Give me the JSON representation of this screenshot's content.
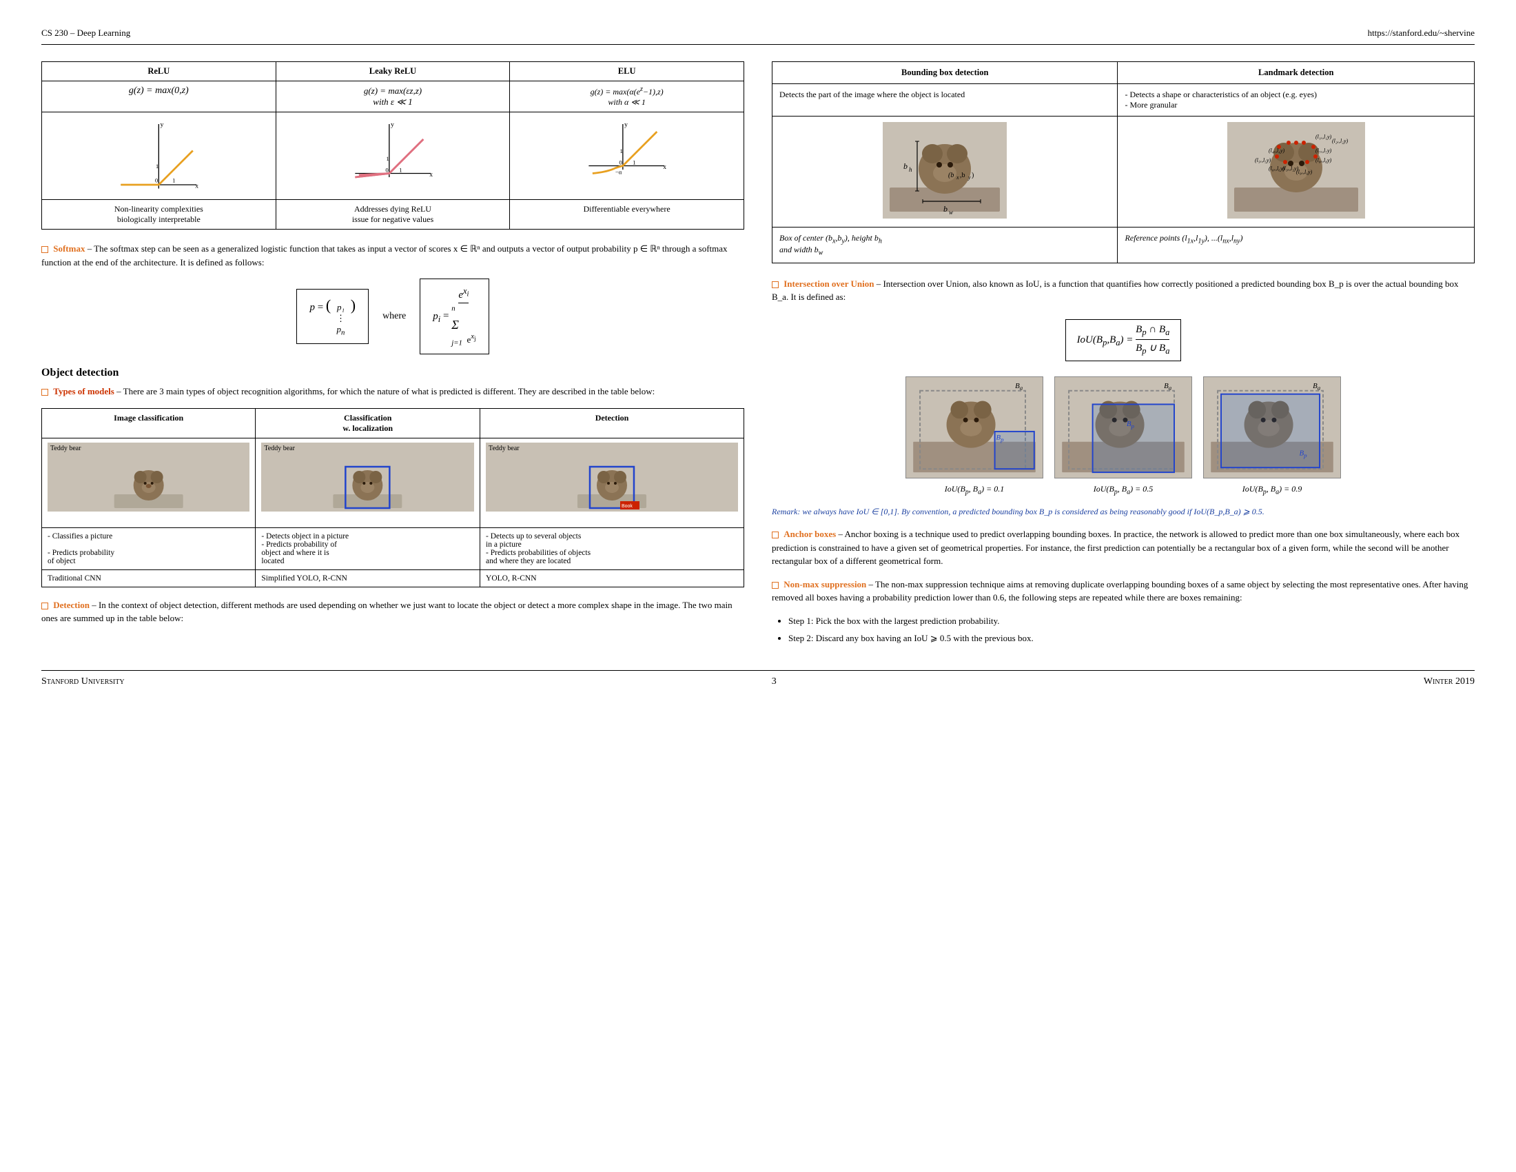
{
  "header": {
    "left": "CS 230 – Deep Learning",
    "right": "https://stanford.edu/~shervine"
  },
  "footer": {
    "left": "Stanford University",
    "center": "3",
    "right": "Winter 2019"
  },
  "activation_table": {
    "columns": [
      "ReLU",
      "Leaky ReLU",
      "ELU"
    ],
    "formulas": [
      "g(z) = max(0,z)",
      "g(z) = max(εz,z) with ε ≪ 1",
      "g(z) = max(α(eᶻ−1),z) with α ≪ 1"
    ],
    "descriptions": [
      "Non-linearity complexities biologically interpretable",
      "Addresses dying ReLU issue for negative values",
      "Differentiable everywhere"
    ]
  },
  "softmax": {
    "label": "Softmax",
    "text": "– The softmax step can be seen as a generalized logistic function that takes as input a vector of scores x ∈ ℝⁿ and outputs a vector of output probability p ∈ ℝⁿ through a softmax function at the end of the architecture. It is defined as follows:"
  },
  "object_detection_title": "Object detection",
  "types_of_models": {
    "label": "Types of models",
    "text": "– There are 3 main types of object recognition algorithms, for which the nature of what is predicted is different. They are described in the table below:",
    "columns": [
      "Image classification",
      "Classification w. localization",
      "Detection"
    ],
    "row1_labels": [
      "Teddy bear",
      "Teddy bear",
      "Teddy bear"
    ],
    "row2": [
      "- Classifies a picture\n- Predicts probability of object",
      "- Detects object in a picture\n- Predicts probability of object and where it is located",
      "- Detects up to several objects in a picture\n- Predicts probabilities of objects and where they are located"
    ],
    "row3": [
      "Traditional CNN",
      "Simplified YOLO, R-CNN",
      "YOLO, R-CNN"
    ]
  },
  "detection": {
    "label": "Detection",
    "text": "– In the context of object detection, different methods are used depending on whether we just want to locate the object or detect a more complex shape in the image. The two main ones are summed up in the table below:"
  },
  "bb_table": {
    "col1": "Bounding box detection",
    "col2": "Landmark detection",
    "desc1": "Detects the part of the image where the object is located",
    "desc2": "- Detects a shape or characteristics of an object (e.g. eyes)\n- More granular",
    "formula1": "Box of center (bₓ,b_y), height b_h and width b_w",
    "formula2": "Reference points (l₁ₓ,l₁y), ...,(l_nₓ,l_ny)"
  },
  "iou": {
    "label": "Intersection over Union",
    "text": "– Intersection over Union, also known as IoU, is a function that quantifies how correctly positioned a predicted bounding box B_p is over the actual bounding box B_a. It is defined as:",
    "formula": "IoU(B_p,B_a) = (B_p ∩ B_a) / (B_p ∪ B_a)",
    "images": [
      {
        "label": "IoU(B_p, B_a) = 0.1"
      },
      {
        "label": "IoU(B_p, B_a) = 0.5"
      },
      {
        "label": "IoU(B_p, B_a) = 0.9"
      }
    ],
    "remark": "Remark: we always have IoU ∈ [0,1]. By convention, a predicted bounding box B_p is considered as being reasonably good if IoU(B_p,B_a) ⩾ 0.5."
  },
  "anchor_boxes": {
    "label": "Anchor boxes",
    "text": "– Anchor boxing is a technique used to predict overlapping bounding boxes. In practice, the network is allowed to predict more than one box simultaneously, where each box prediction is constrained to have a given set of geometrical properties. For instance, the first prediction can potentially be a rectangular box of a given form, while the second will be another rectangular box of a different geometrical form."
  },
  "non_max": {
    "label": "Non-max suppression",
    "text": "– The non-max suppression technique aims at removing duplicate overlapping bounding boxes of a same object by selecting the most representative ones. After having removed all boxes having a probability prediction lower than 0.6, the following steps are repeated while there are boxes remaining:",
    "steps": [
      "Step 1: Pick the box with the largest prediction probability.",
      "Step 2: Discard any box having an IoU ⩾ 0.5 with the previous box."
    ]
  },
  "union_text": "Union"
}
